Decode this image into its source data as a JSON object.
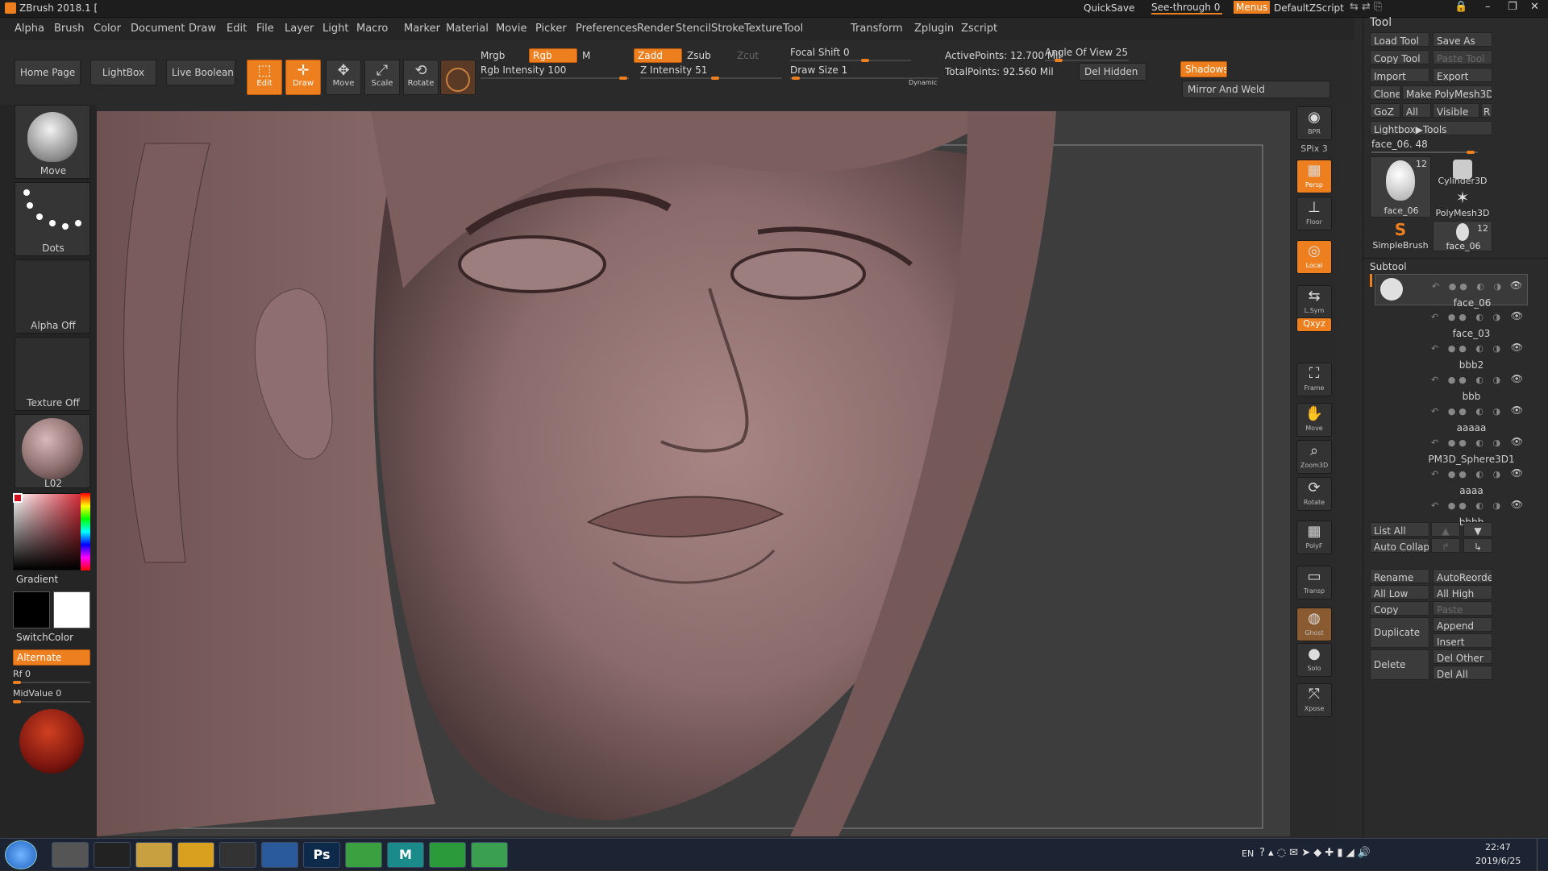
{
  "title": {
    "app": "ZBrush 2018.1 [",
    "quicksave": "QuickSave",
    "see_through": "See-through",
    "see_through_value": "0",
    "menus": "Menus",
    "script": "DefaultZScript"
  },
  "menubar": [
    "Alpha",
    "Brush",
    "Color",
    "Document",
    "Draw",
    "Edit",
    "File",
    "Layer",
    "Light",
    "Macro",
    "Marker",
    "Material",
    "Movie",
    "Picker",
    "Preferences",
    "Render",
    "Stencil",
    "Stroke",
    "Texture",
    "Tool",
    "Transform",
    "Zplugin",
    "Zscript"
  ],
  "toolbar": {
    "home_page": "Home Page",
    "lightbox": "LightBox",
    "live_boolean": "Live Boolean",
    "edit": "Edit",
    "draw": "Draw",
    "move": "Move",
    "scale": "Scale",
    "rotate": "Rotate",
    "mrgb": "Mrgb",
    "rgb": "Rgb",
    "m": "M",
    "rgb_intensity": "Rgb Intensity 100",
    "zadd": "Zadd",
    "zsub": "Zsub",
    "zcut": "Zcut",
    "z_intensity": "Z Intensity 51",
    "focal_shift": "Focal Shift 0",
    "draw_size": "Draw Size 1",
    "dynamic": "Dynamic",
    "active_points": "ActivePoints: 12.700 Mil",
    "angle_of_view": "Angle Of View 25",
    "total_points": "TotalPoints: 92.560 Mil",
    "del_hidden": "Del Hidden",
    "shadows": "Shadows",
    "mirror_weld": "Mirror And Weld"
  },
  "left_shelf": {
    "brush": "Move",
    "stroke": "Dots",
    "alpha": "Alpha Off",
    "texture": "Texture Off",
    "material": "L02",
    "gradient": "Gradient",
    "switch_color": "SwitchColor",
    "alternate": "Alternate",
    "rf": "Rf 0",
    "midvalue": "MidValue 0"
  },
  "right_shelf": [
    {
      "name": "bpr",
      "label": "BPR",
      "icon": "◉"
    },
    {
      "name": "spix",
      "label": "SPix 3",
      "icon": ""
    },
    {
      "name": "persp",
      "label": "Persp",
      "icon": "▦"
    },
    {
      "name": "floor",
      "label": "Floor",
      "icon": "⊥"
    },
    {
      "name": "local",
      "label": "Local",
      "icon": "◎"
    },
    {
      "name": "lsym",
      "label": "L.Sym",
      "icon": "⇆"
    },
    {
      "name": "xyz",
      "label": "Qxyz",
      "icon": ""
    },
    {
      "name": "frame",
      "label": "Frame",
      "icon": "⛶"
    },
    {
      "name": "move",
      "label": "Move",
      "icon": "✋"
    },
    {
      "name": "zoom3d",
      "label": "Zoom3D",
      "icon": "⌕"
    },
    {
      "name": "rotate",
      "label": "Rotate",
      "icon": "⟳"
    },
    {
      "name": "polyf",
      "label": "PolyF",
      "icon": "▦"
    },
    {
      "name": "transp",
      "label": "Transp",
      "icon": "▭"
    },
    {
      "name": "ghost",
      "label": "Ghost",
      "icon": "◍"
    },
    {
      "name": "solo",
      "label": "Solo",
      "icon": "●"
    },
    {
      "name": "xpose",
      "label": "Xpose",
      "icon": "⤧"
    }
  ],
  "tool_panel": {
    "title": "Tool",
    "load_tool": "Load Tool",
    "save_as": "Save As",
    "copy_tool": "Copy Tool",
    "paste_tool": "Paste Tool",
    "import": "Import",
    "export": "Export",
    "clone": "Clone",
    "make_polymesh": "Make PolyMesh3D",
    "goz": "GoZ",
    "all": "All",
    "visible": "Visible",
    "r": "R",
    "lightbox_tools": "Lightbox▶Tools",
    "current_tool": "face_06. 48",
    "thumbs": [
      {
        "label": "face_06",
        "count": "12"
      },
      {
        "label": "Cylinder3D",
        "count": ""
      },
      {
        "label": "PolyMesh3D",
        "count": ""
      },
      {
        "label": "SimpleBrush",
        "count": ""
      },
      {
        "label": "face_06",
        "count": "12"
      }
    ],
    "subtool_title": "Subtool",
    "subtools": [
      "face_06",
      "face_03",
      "bbb2",
      "bbb",
      "aaaaa",
      "PM3D_Sphere3D1",
      "aaaa",
      "bbbb"
    ],
    "list_all": "List All",
    "auto_collapse": "Auto Collapse",
    "rename": "Rename",
    "autoreorder": "AutoReorder",
    "all_low": "All Low",
    "all_high": "All High",
    "copy": "Copy",
    "paste": "Paste",
    "duplicate": "Duplicate",
    "append": "Append",
    "insert": "Insert",
    "delete": "Delete",
    "del_other": "Del Other",
    "del_all": "Del All"
  },
  "taskbar": {
    "apps": [
      "start",
      "chrome-dev",
      "app-red",
      "explorer",
      "sketchbook",
      "zbrush",
      "sublime",
      "photoshop",
      "wechat",
      "maya",
      "camtasia",
      "app-green"
    ],
    "app_labels": {
      "photoshop": "Ps",
      "maya": "M"
    },
    "lang": "EN",
    "time": "22:47",
    "date": "2019/6/25"
  },
  "colors": {
    "accent": "#ee7f1f",
    "bg": "#2b2b2b",
    "skin": "#8e6f6f"
  }
}
